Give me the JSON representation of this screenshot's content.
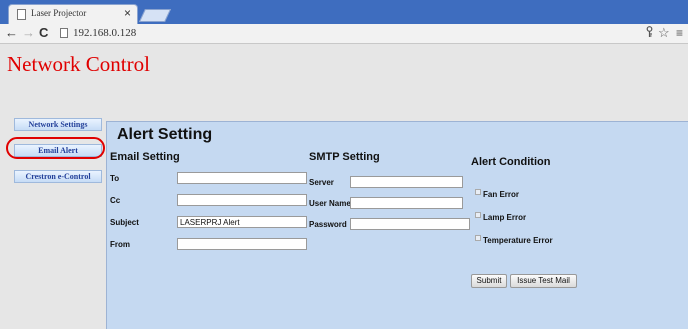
{
  "browser": {
    "tab_title": "Laser Projector",
    "tab_close": "×",
    "url": "192.168.0.128",
    "nav": {
      "back": "←",
      "forward": "→",
      "reload": "C"
    },
    "toolbar_icons": {
      "key": "key-icon",
      "star": "☆",
      "menu": "≡"
    }
  },
  "page": {
    "title": "Network Control",
    "sidebar": [
      {
        "label": "Network Settings"
      },
      {
        "label": "Email Alert"
      },
      {
        "label": "Crestron e-Control"
      }
    ],
    "highlight_color": "#e00000",
    "alert": {
      "heading": "Alert Setting",
      "email_setting": {
        "heading": "Email Setting",
        "fields": [
          {
            "label": "To",
            "value": ""
          },
          {
            "label": "Cc",
            "value": ""
          },
          {
            "label": "Subject",
            "value": "LASERPRJ Alert"
          },
          {
            "label": "From",
            "value": ""
          }
        ]
      },
      "smtp_setting": {
        "heading": "SMTP Setting",
        "fields": [
          {
            "label": "Server",
            "value": ""
          },
          {
            "label": "User Name",
            "value": ""
          },
          {
            "label": "Password",
            "value": ""
          }
        ]
      },
      "alert_condition": {
        "heading": "Alert Condition",
        "items": [
          {
            "label": "Fan Error",
            "checked": false
          },
          {
            "label": "Lamp Error",
            "checked": false
          },
          {
            "label": "Temperature Error",
            "checked": false
          }
        ]
      },
      "buttons": {
        "submit": "Submit",
        "test": "Issue Test Mail"
      }
    }
  }
}
